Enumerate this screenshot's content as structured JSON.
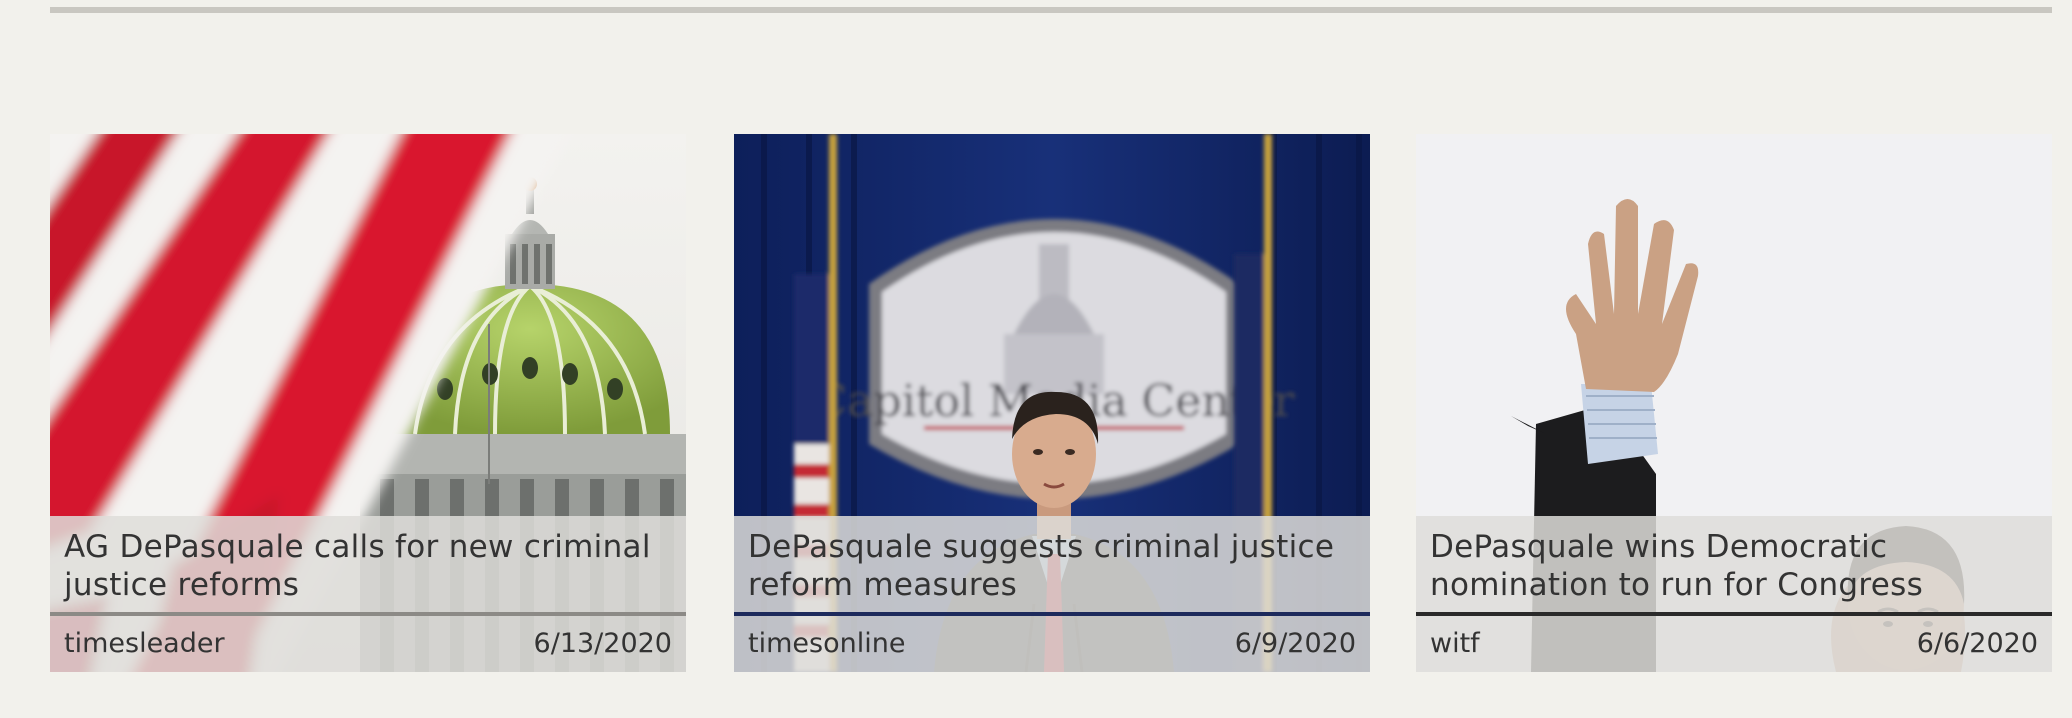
{
  "articles": [
    {
      "title": "AG DePasquale calls for new criminal justice reforms",
      "source": "timesleader",
      "date": "6/13/2020",
      "image_icon": "capitol-dome-with-flag-image",
      "accent": "#8c8a86"
    },
    {
      "title": "DePasquale suggests criminal justice reform measures",
      "source": "timesonline",
      "date": "6/9/2020",
      "image_icon": "press-conference-image",
      "podium_text": "Capitol Media Center",
      "accent": "#1d2a5c"
    },
    {
      "title": "DePasquale wins Democratic nomination to run for Congress",
      "source": "witf",
      "date": "6/6/2020",
      "image_icon": "waving-candidate-image",
      "accent": "#2a2a2a"
    }
  ]
}
